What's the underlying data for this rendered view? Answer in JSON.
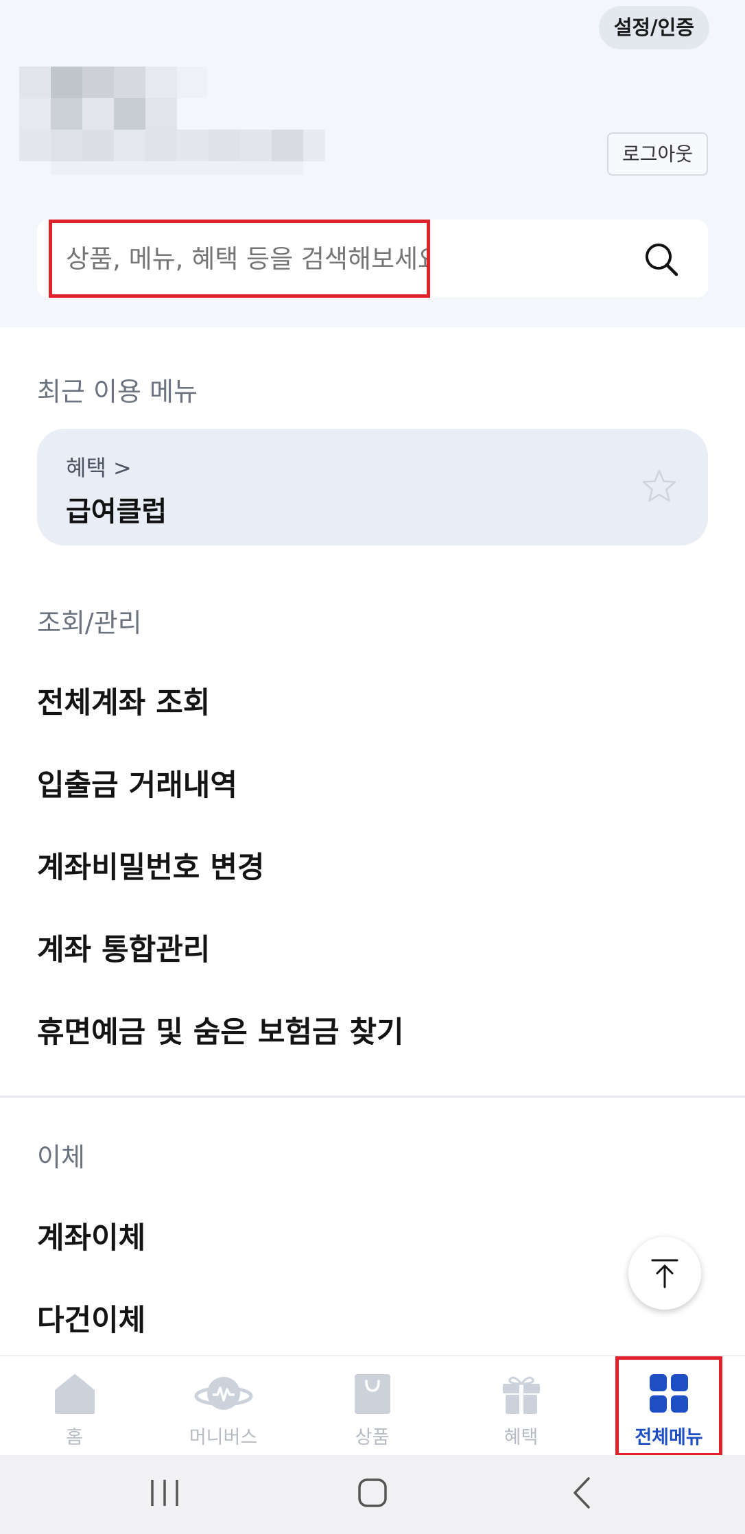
{
  "header": {
    "settings_label": "설정/인증",
    "logout_label": "로그아웃"
  },
  "search": {
    "placeholder": "상품, 메뉴, 혜택 등을 검색해보세요."
  },
  "recent": {
    "title": "최근 이용 메뉴",
    "category": "혜택 >",
    "name": "급여클럽"
  },
  "sections": [
    {
      "title": "조회/관리",
      "items": [
        "전체계좌 조회",
        "입출금 거래내역",
        "계좌비밀번호 변경",
        "계좌 통합관리",
        "휴면예금 및 숨은 보험금 찾기"
      ]
    },
    {
      "title": "이체",
      "items": [
        "계좌이체",
        "다건이체"
      ]
    }
  ],
  "tabbar": {
    "items": [
      {
        "label": "홈",
        "icon": "home-icon"
      },
      {
        "label": "머니버스",
        "icon": "planet-icon"
      },
      {
        "label": "상품",
        "icon": "shopping-bag-icon"
      },
      {
        "label": "혜택",
        "icon": "gift-icon"
      },
      {
        "label": "전체메뉴",
        "icon": "grid-icon",
        "active": true
      }
    ]
  },
  "colors": {
    "accent": "#1d4ec4",
    "highlight_border": "#e0202a",
    "top_background": "#f3f6fb"
  }
}
